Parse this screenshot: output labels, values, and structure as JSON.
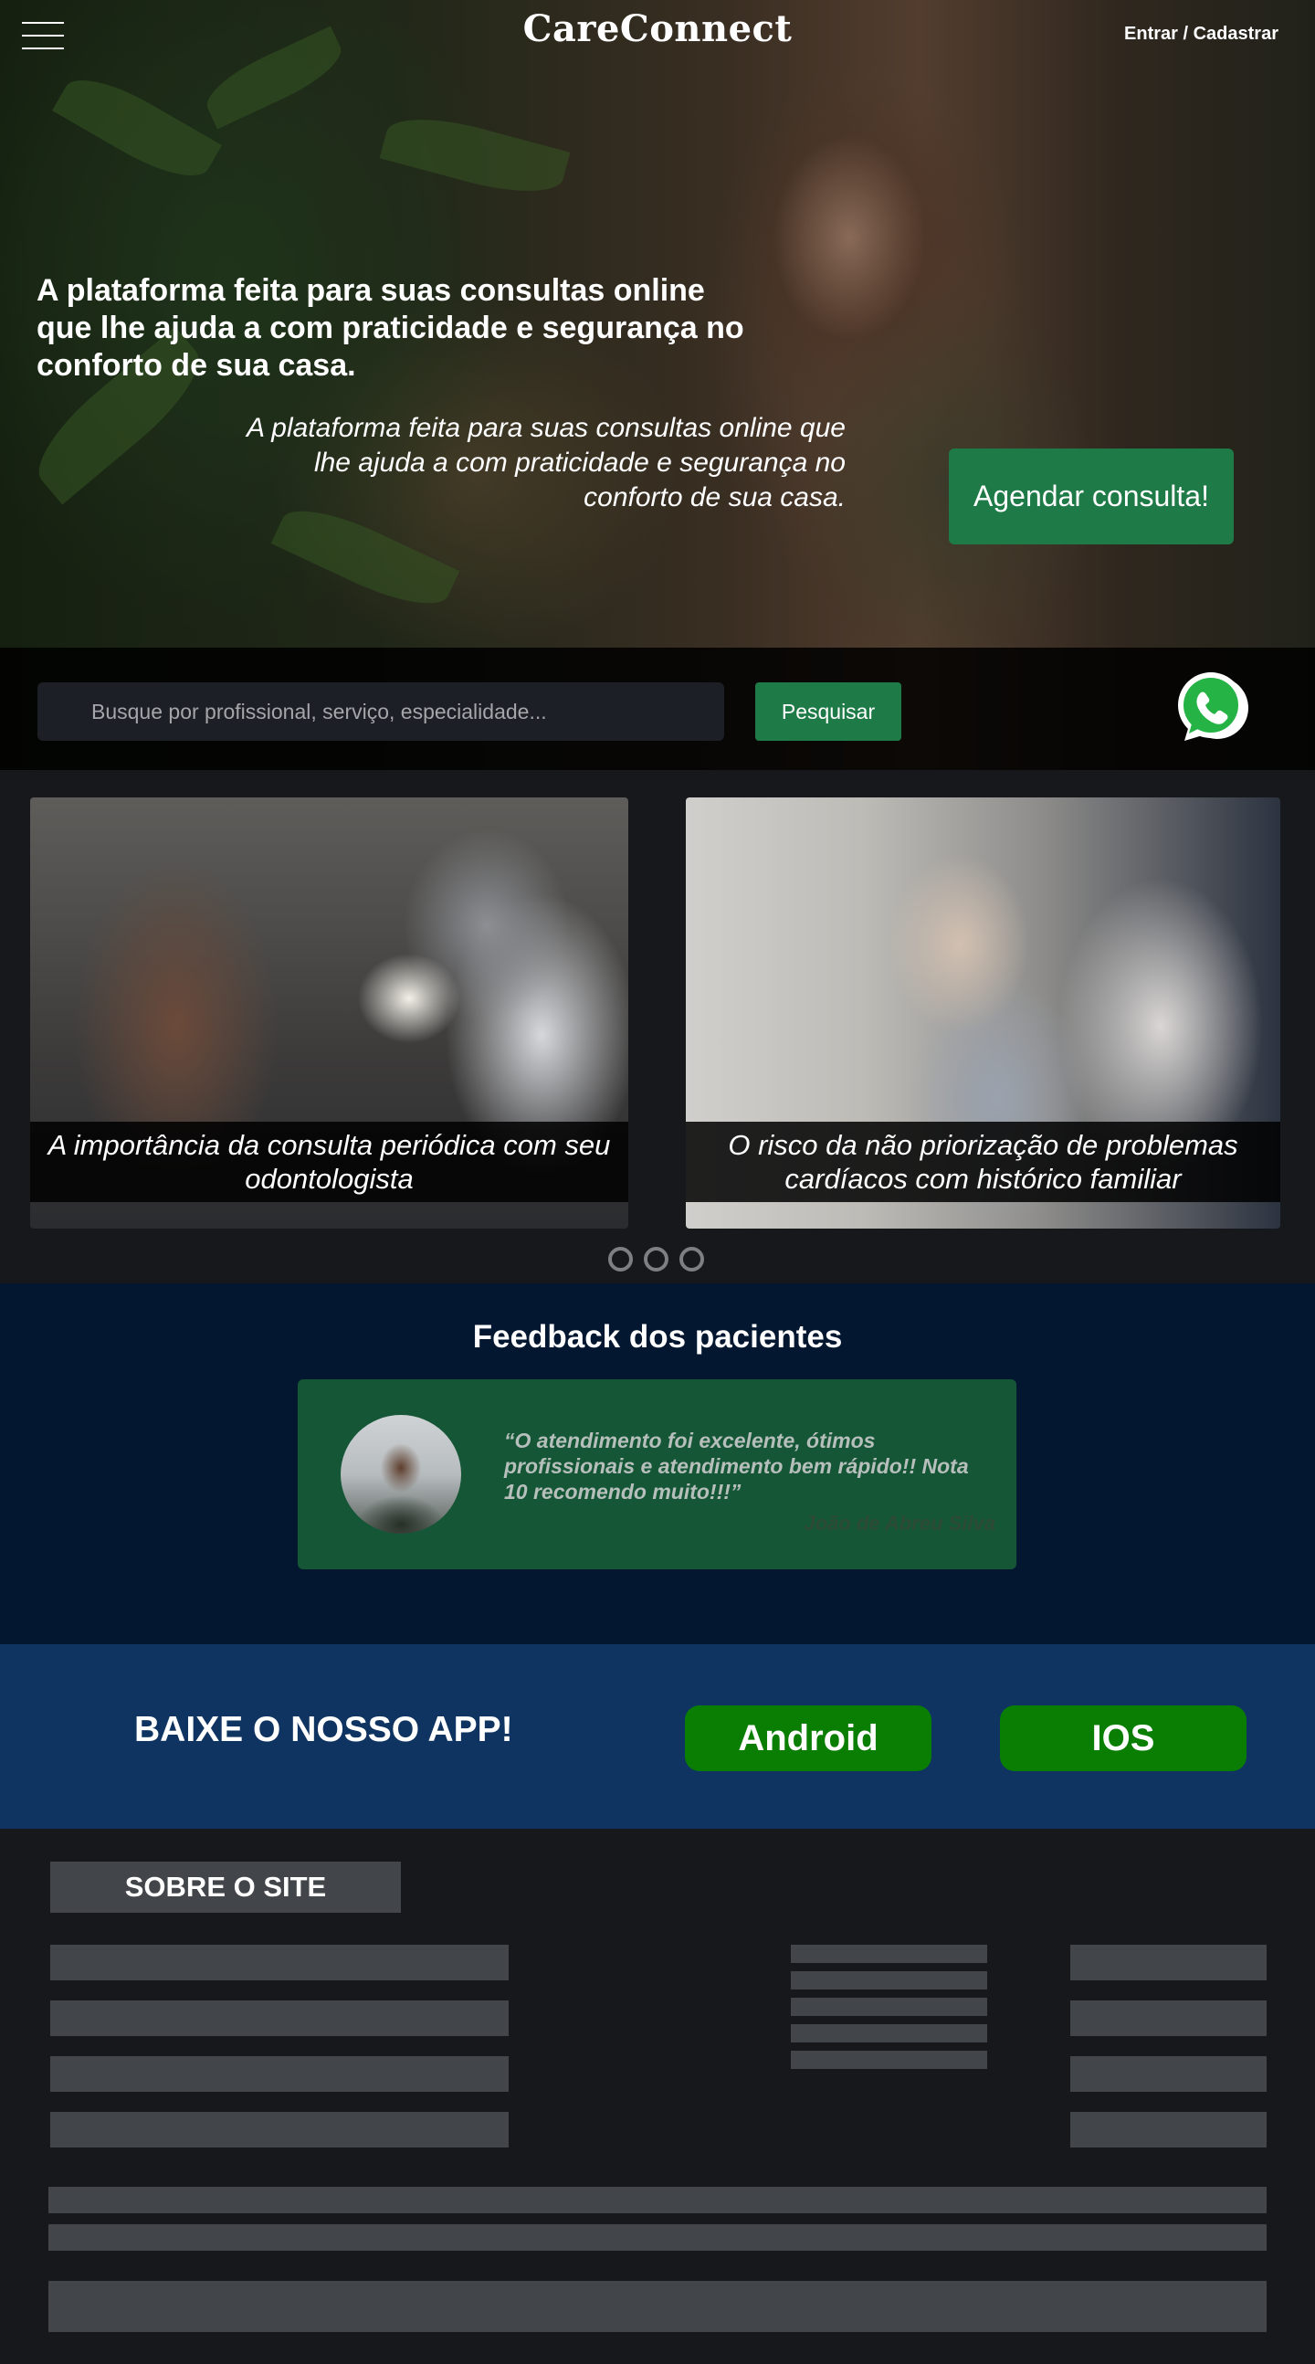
{
  "header": {
    "logo": "CareConnect",
    "login_label": "Entrar / Cadastrar",
    "menu_icon": "hamburger-menu-icon"
  },
  "hero": {
    "title": "A plataforma feita para suas consultas online que lhe ajuda a com praticidade e segurança no conforto de sua casa.",
    "subtitle": "A plataforma feita para suas consultas online que lhe ajuda a com praticidade e segurança no conforto de sua casa.",
    "cta_label": "Agendar consulta!"
  },
  "search": {
    "placeholder": "Busque por profissional, serviço, especialidade...",
    "button_label": "Pesquisar",
    "whatsapp_icon": "whatsapp-icon"
  },
  "articles": {
    "items": [
      {
        "caption": "A importância da consulta periódica com seu odontologista"
      },
      {
        "caption": "O risco da não priorização de problemas cardíacos com histórico familiar"
      }
    ],
    "dots": 3
  },
  "feedback": {
    "title": "Feedback dos pacientes",
    "quote": "“O atendimento foi excelente, ótimos profissionais e atendimento bem rápido!! Nota 10 recomendo muito!!!”",
    "author": "João de Abreu Silva"
  },
  "app": {
    "title": "BAIXE O NOSSO APP!",
    "android_label": "Android",
    "ios_label": "IOS"
  },
  "footer": {
    "heading": "SOBRE O SITE"
  },
  "colors": {
    "accent_green": "#1e7a46",
    "store_green": "#097e02",
    "feedback_bg": "#041730",
    "app_bg": "#0f3461",
    "footer_bg": "#16181c"
  }
}
